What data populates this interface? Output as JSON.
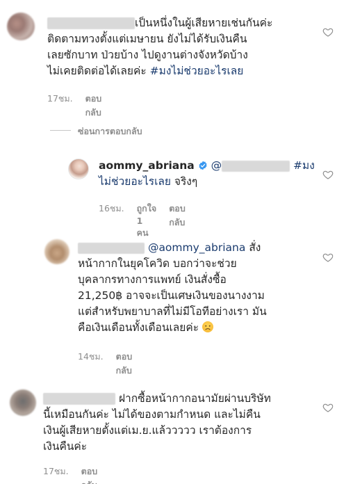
{
  "comments": [
    {
      "text": "เป็นหนึ่งในผู้เสียหายเช่นกันค่ะ ติดตามทวงตั้งแต่เมษายน ยังไม่ได้รับเงินคืน เลยซักบาท ป่วยบ้าง ไปดูงานต่างจังหวัดบ้าง ไม่เคยติดต่อได้เลยค่ะ",
      "line1": "เป็นหนึ่งในผู้เสียหายเช่นกันค่ะ",
      "line2": "ติดตามทวงตั้งแต่เมษายน ยังไม่ได้รับเงินคืน",
      "line3": "เลยซักบาท ป่วยบ้าง ไปดูงานต่างจังหวัดบ้าง",
      "line4": "ไม่เคยติดต่อได้เลยค่ะ",
      "hashtag": "#มงไม่ช่วยอะไรเลย",
      "time": "17ชม.",
      "reply": "ตอบกลับ"
    },
    {
      "line4_a": "ฝากซื้อหน้ากากอนามัยผ่านบริษัท",
      "line4_b": "นี้เหมือนกันค่ะ ไม่ได้ของตามกำหนด และไม่คืน",
      "line4_c": "เงินผู้เสียหายตั้งแต่เม.ย.แล้ววววว เราต้องการ",
      "line4_d": "เงินคืนค่ะ",
      "time": "17ชม.",
      "reply": "ตอบกลับ"
    }
  ],
  "hide_replies": "ซ่อนการตอบกลับ",
  "replies": [
    {
      "username": "aommy_abriana",
      "mention_prefix": "@",
      "hashtag_a": "#มง",
      "hashtag_b": "ไม่ช่วยอะไรเลย",
      "suffix": "จริงๆ",
      "time": "16ชม.",
      "likes": "ถูกใจ 1 คน",
      "reply": "ตอบกลับ"
    },
    {
      "mention": "@aommy_abriana",
      "l1_tail": "สั่ง",
      "l2": "หน้ากากในยุคโควิด บอกว่าจะช่วย",
      "l3": "บุคลากรทางการแพทย์ เงินสั่งซื้อ",
      "l4": "21,250฿ อาจจะเป็นเศษเงินของนางงาม",
      "l5": "แต่สำหรับพยาบาลที่ไม่มีโอทีอย่างเรา มัน",
      "l6": "คือเงินเดือนทั้งเดือนเลยค่ะ",
      "time": "14ชม.",
      "reply": "ตอบกลับ"
    }
  ],
  "icons": {
    "like": "heart-outline-icon",
    "verified": "verified-badge-icon",
    "emoji": "sad-face-emoji"
  },
  "colors": {
    "hashtag": "#1a3b6e",
    "meta": "#8e8e8e",
    "verified": "#3897f0"
  }
}
